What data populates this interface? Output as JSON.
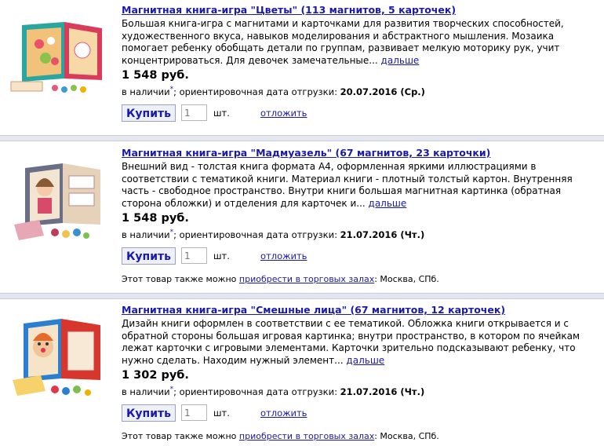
{
  "products": [
    {
      "title": "Магнитная книга-игра \"Цветы\" (113 магнитов, 5 карточек)",
      "description": "Большая книга-игра с магнитами и карточками для развития творческих способностей, художественного вкуса, навыков моделирования и абстрактного мышления. Мозаика помогает ребенку обобщать детали по группам, развивает мелкую моторику рук, учит концентрироваться. Для девочек замечательные...",
      "more_label": "дальше",
      "price": "1 548 руб.",
      "stock_label": "в наличии",
      "stock_asterisk": "*",
      "shipping_text": "; ориентировочная дата отгрузки:",
      "shipping_date": "20.07.2016 (Ср.)",
      "buy_label": "Купить",
      "qty_placeholder": "1",
      "unit": "шт.",
      "defer_label": "отложить"
    },
    {
      "title": "Магнитная книга-игра \"Мадмуазель\" (67 магнитов, 23 карточки)",
      "description": "Внешний вид - толстая книга формата А4, оформленная яркими иллюстрациями в соответствии с тематикой книги. Материал книги - плотный толстый картон. Внутренняя часть - свободное пространство. Внутри книги большая магнитная картинка (обратная сторона обложки) и отделения для карточек и...",
      "more_label": "дальше",
      "price": "1 548 руб.",
      "stock_label": "в наличии",
      "stock_asterisk": "*",
      "shipping_text": "; ориентировочная дата отгрузки:",
      "shipping_date": "21.07.2016 (Чт.)",
      "buy_label": "Купить",
      "qty_placeholder": "1",
      "unit": "шт.",
      "defer_label": "отложить",
      "also_prefix": "Этот товар также можно",
      "also_link": "приобрести в торговых залах",
      "also_suffix": ": Москва, СПб."
    },
    {
      "title": "Магнитная книга-игра \"Смешные лица\" (67 магнитов, 12 карточек)",
      "description": "Дизайн книги оформлен в соответствии с ее тематикой. Обложка книги открывается и с обратной стороны большая игровая картинка; внутри пространство, в котором по ячейкам лежат карточки с игровыми элементами. Карточки зрительно подсказывают ребенку, что нужно сделать. Находим нужный элемент...",
      "more_label": "дальше",
      "price": "1 302 руб.",
      "stock_label": "в наличии",
      "stock_asterisk": "*",
      "shipping_text": "; ориентировочная дата отгрузки:",
      "shipping_date": "21.07.2016 (Чт.)",
      "buy_label": "Купить",
      "qty_placeholder": "1",
      "unit": "шт.",
      "defer_label": "отложить",
      "also_prefix": "Этот товар также можно",
      "also_link": "приобрести в торговых залах",
      "also_suffix": ": Москва, СПб."
    }
  ]
}
